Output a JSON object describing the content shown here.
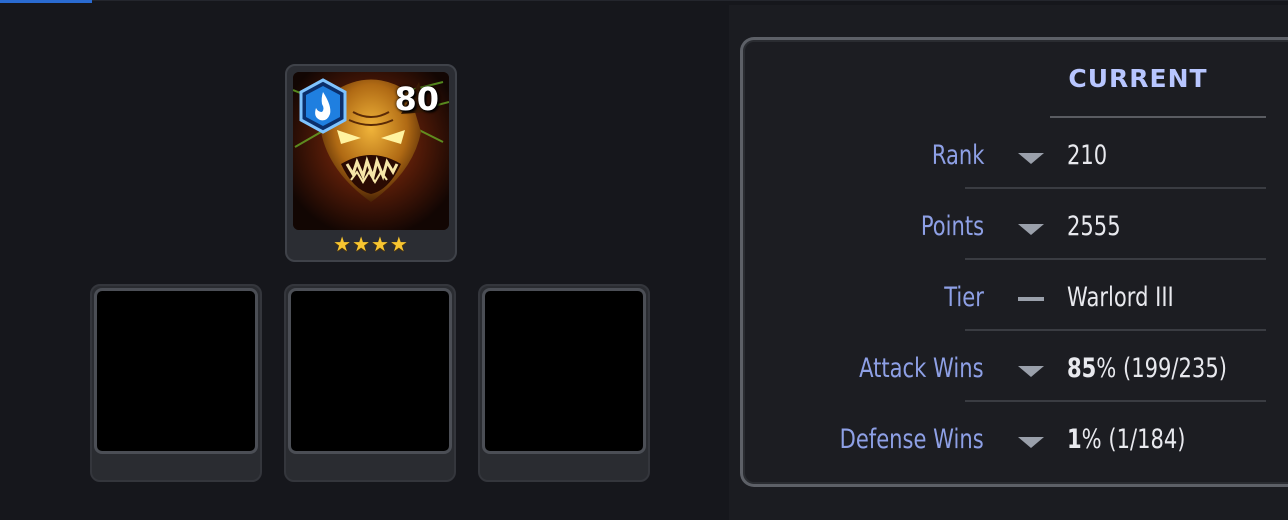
{
  "hero": {
    "level": "80",
    "stars": "★★★★",
    "star_count": 4,
    "class_icon": "mystic-class-icon"
  },
  "slots": [
    "empty-slot",
    "empty-slot",
    "empty-slot"
  ],
  "stats": {
    "column_header": "CURRENT",
    "rows": [
      {
        "label": "Rank",
        "trend": "down",
        "value": "210"
      },
      {
        "label": "Points",
        "trend": "down",
        "value": "2555"
      },
      {
        "label": "Tier",
        "trend": "none",
        "value": "Warlord III"
      },
      {
        "label": "Attack Wins",
        "trend": "down",
        "value_bold": "85",
        "value_unit": "%",
        "value_rest": " (199/235)"
      },
      {
        "label": "Defense Wins",
        "trend": "down",
        "value_bold": "1",
        "value_unit": "%",
        "value_rest": " (1/184)"
      }
    ]
  },
  "colors": {
    "label": "#8ea0e6",
    "header": "#b8c6ff",
    "value": "#e8e9ee",
    "star": "#f7c531",
    "badge": "#1f7fe0"
  }
}
